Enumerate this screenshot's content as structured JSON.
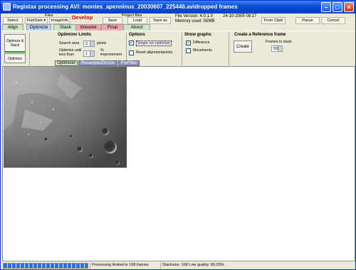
{
  "window": {
    "title": "Registax processing AVI: montes_apenninus_20030607_225446.avidropped frames"
  },
  "toolbar": {
    "files_label": "Files",
    "select": "Select",
    "flatdark": "Flat/Dark ▾",
    "imageinfo": "ImageInfo",
    "develop": "Develop",
    "save": "Save",
    "project_files_label": "Project files",
    "load": "Load",
    "save_as": "Save as",
    "file_version": "File Version: 4.0.1.0",
    "date": "24-10-2005 08:17",
    "memory": "Memory used: 55MB",
    "from_clipb": "From Clipb",
    "pause": "Pause",
    "cancel": "Cancel"
  },
  "tabs": [
    {
      "label": "Align",
      "color": "#cfe5c4"
    },
    {
      "label": "Optimize",
      "color": "#b7d3f2"
    },
    {
      "label": "Stack",
      "color": "#cfe5c4"
    },
    {
      "label": "Wavelet",
      "color": "#f2a6a6"
    },
    {
      "label": "Final",
      "color": "#f2a6a6"
    },
    {
      "label": "About",
      "color": "#cfe5c4"
    }
  ],
  "side_buttons": {
    "optimize_stack": "Optimize & Stack",
    "optimize": "Optimize"
  },
  "optimizer_limits": {
    "title": "Optimizer Limits",
    "search_area_label": "Search area",
    "search_area_value": "2",
    "search_area_unit": "pixels",
    "until_label_1": "Optimize until",
    "until_label_2": "less than",
    "until_value": "1",
    "until_unit_1": "%",
    "until_unit_2": "improvement"
  },
  "options": {
    "title": "Options",
    "single_run": "Single run optimizer",
    "single_run_checked": true,
    "reset_align": "Reset alignmentpoints",
    "reset_align_checked": false
  },
  "show_graphs": {
    "title": "Show graphs",
    "difference": "Difference",
    "difference_checked": true,
    "movements": "Movements",
    "movements_checked": false
  },
  "reference": {
    "title": "Create a Reference frame",
    "create": "Create",
    "frames_label": "Frames to stack",
    "frames_value": "50"
  },
  "subtabs": [
    {
      "label": "Optimizer"
    },
    {
      "label": "Resample/Drizzle"
    },
    {
      "label": "PreFilter"
    }
  ],
  "status": {
    "progress_fraction": 1.0,
    "processing": "Processing limited to 168 frames",
    "stacksize": "Stacksize: 168 Low quality: 80,03%"
  }
}
